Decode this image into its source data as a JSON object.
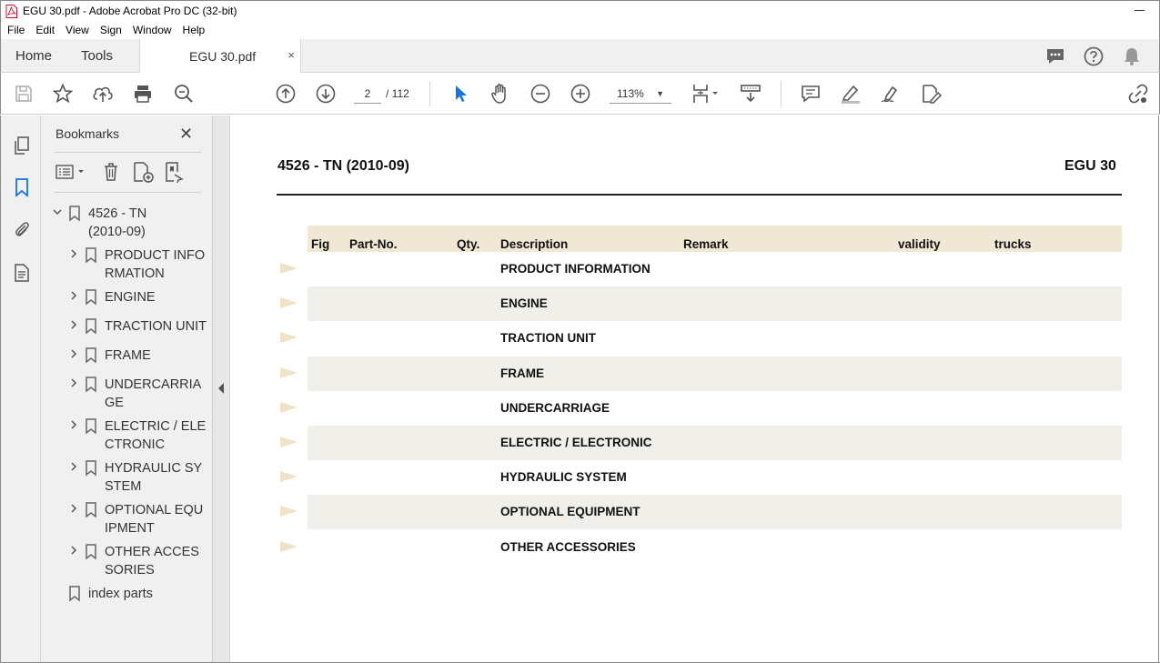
{
  "window": {
    "title": "EGU 30.pdf - Adobe Acrobat Pro DC (32-bit)"
  },
  "menu": [
    "File",
    "Edit",
    "View",
    "Sign",
    "Window",
    "Help"
  ],
  "tabs": {
    "home": "Home",
    "tools": "Tools",
    "document": "EGU 30.pdf",
    "close": "×"
  },
  "toolbar": {
    "page_current": "2",
    "page_total": "/ 112",
    "zoom": "113%"
  },
  "bookmarks_panel": {
    "title": "Bookmarks",
    "root": "4526 - TN (2010-09)",
    "items": [
      "PRODUCT INFORMATION",
      "ENGINE",
      "TRACTION UNIT",
      "FRAME",
      "UNDERCARRIAGE",
      "ELECTRIC / ELECTRONIC",
      "HYDRAULIC SYSTEM",
      "OPTIONAL EQUIPMENT",
      "OTHER ACCESSORIES"
    ],
    "last": "index parts"
  },
  "document": {
    "header_left": "4526 - TN (2010-09)",
    "header_right": "EGU 30",
    "columns": [
      "Fig",
      "Part-No.",
      "Qty.",
      "Description",
      "Remark",
      "validity",
      "trucks"
    ],
    "rows": [
      "PRODUCT INFORMATION",
      "ENGINE",
      "TRACTION UNIT",
      "FRAME",
      "UNDERCARRIAGE",
      "ELECTRIC / ELECTRONIC",
      "HYDRAULIC SYSTEM",
      "OPTIONAL EQUIPMENT",
      "OTHER ACCESSORIES"
    ]
  },
  "colors": {
    "table_header": "#f0e7d5",
    "row_shade": "#f1efe9",
    "arrow": "#eee3c7",
    "accent": "#1473e6"
  }
}
